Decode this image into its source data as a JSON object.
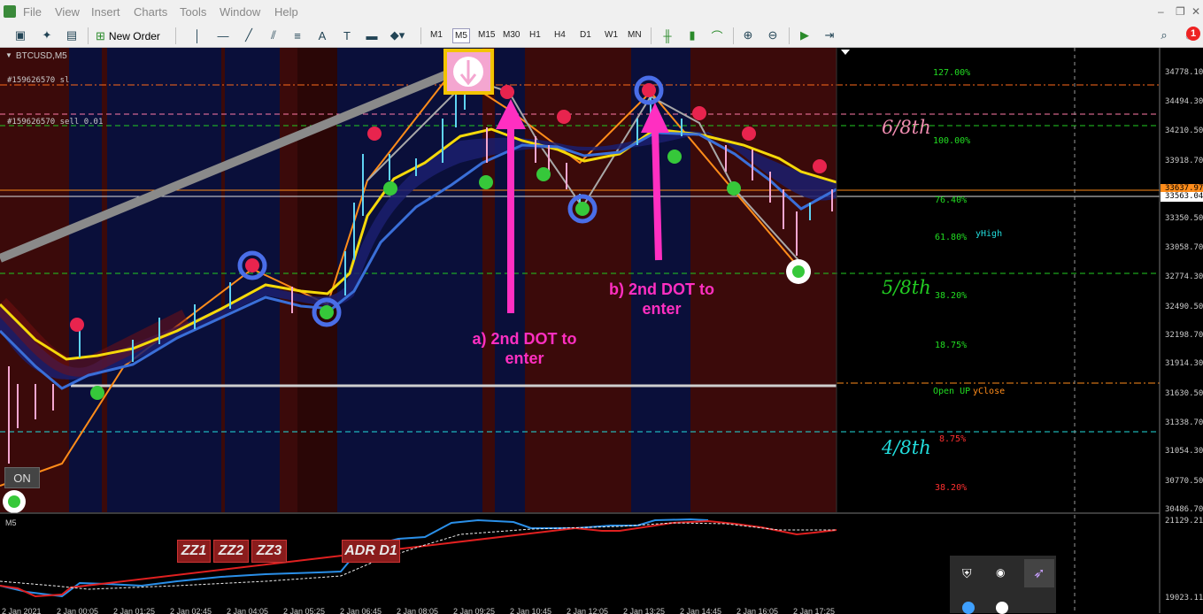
{
  "menu": {
    "file": "File",
    "view": "View",
    "insert": "Insert",
    "charts": "Charts",
    "tools": "Tools",
    "window": "Window",
    "help": "Help"
  },
  "toolbar": {
    "new_order": "New Order",
    "timeframes": [
      "M1",
      "M5",
      "M15",
      "M30",
      "H1",
      "H4",
      "D1",
      "W1",
      "MN"
    ],
    "active_timeframe": "M5"
  },
  "notification_count": "1",
  "chart": {
    "symbol": "BTCUSD,M5",
    "order_sl": "#159626570 sl",
    "order_sell": "#159626570 sell 0.01",
    "indicator_window_label": "M5",
    "on_button": "ON",
    "buttons": [
      "ZZ1",
      "ZZ2",
      "ZZ3",
      "ADR D1"
    ],
    "price_axis": [
      "34778.10",
      "34494.30",
      "34210.50",
      "33918.70",
      "33637.97",
      "33563.04",
      "33350.50",
      "33058.70",
      "32774.30",
      "32490.50",
      "32198.70",
      "31914.30",
      "31630.50",
      "31338.70",
      "31054.30",
      "30770.50",
      "30486.70"
    ],
    "sub_axis": [
      "21129.215",
      "19023.115"
    ],
    "time_axis": [
      "2 Jan 2021",
      "2 Jan 00:05",
      "2 Jan 01:25",
      "2 Jan 02:45",
      "2 Jan 04:05",
      "2 Jan 05:25",
      "2 Jan 06:45",
      "2 Jan 08:05",
      "2 Jan 09:25",
      "2 Jan 10:45",
      "2 Jan 12:05",
      "2 Jan 13:25",
      "2 Jan 14:45",
      "2 Jan 16:05",
      "2 Jan 17:25"
    ],
    "fib_levels": [
      "127.00%",
      "100.00%",
      "76.40%",
      "61.80%",
      "38.20%",
      "18.75%",
      "Open UP",
      "8.75%",
      "38.20%"
    ],
    "yhigh": "yHigh",
    "yclose": "yClose",
    "murrey": [
      "6/8th",
      "5/8th",
      "4/8th"
    ],
    "annotation_a": "a) 2nd DOT to enter",
    "annotation_b": "b) 2nd DOT to enter",
    "colors": {
      "up_candle": "#5fd3f3",
      "down_candle": "#f4a6d0",
      "ma_yellow": "#f5d90a",
      "ma_blue": "#3a6fd8",
      "zigzag_orange": "#ff8c1a",
      "arrow_magenta": "#ff2fc1",
      "fib_green": "#22dd22",
      "fib_red": "#ff3030"
    }
  }
}
